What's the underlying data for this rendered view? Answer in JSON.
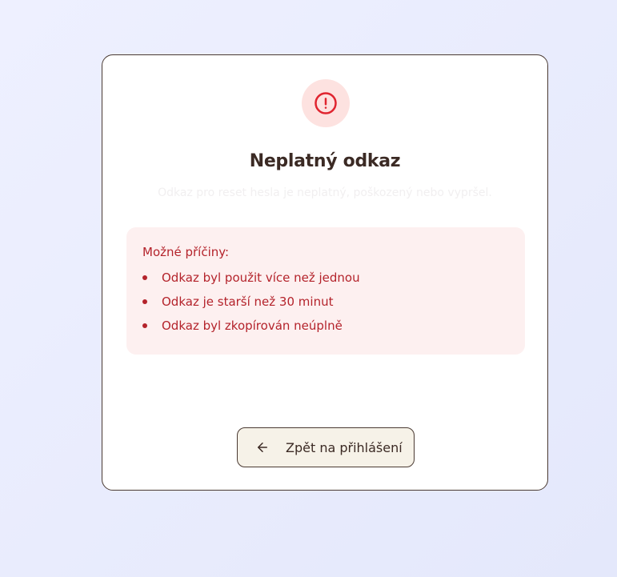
{
  "card": {
    "icon": "alert-circle-icon",
    "title": "Neplatný odkaz",
    "subtitle": "Odkaz pro reset hesla je neplatný, poškozený nebo vypršel."
  },
  "reasons": {
    "heading": "Možné příčiny:",
    "items": [
      "Odkaz byl použit více než jednou",
      "Odkaz je starší než 30 minut",
      "Odkaz byl zkopírován neúplně"
    ]
  },
  "back_button": {
    "icon": "arrow-left-icon",
    "label": "Zpět na přihlášení"
  },
  "colors": {
    "accent_red": "#b4232b",
    "icon_red": "#e0242f",
    "icon_bg": "#fde2e0",
    "reasons_bg": "#fdf0f0",
    "text_dark": "#3b2a24",
    "button_bg": "#f6f2e8"
  }
}
